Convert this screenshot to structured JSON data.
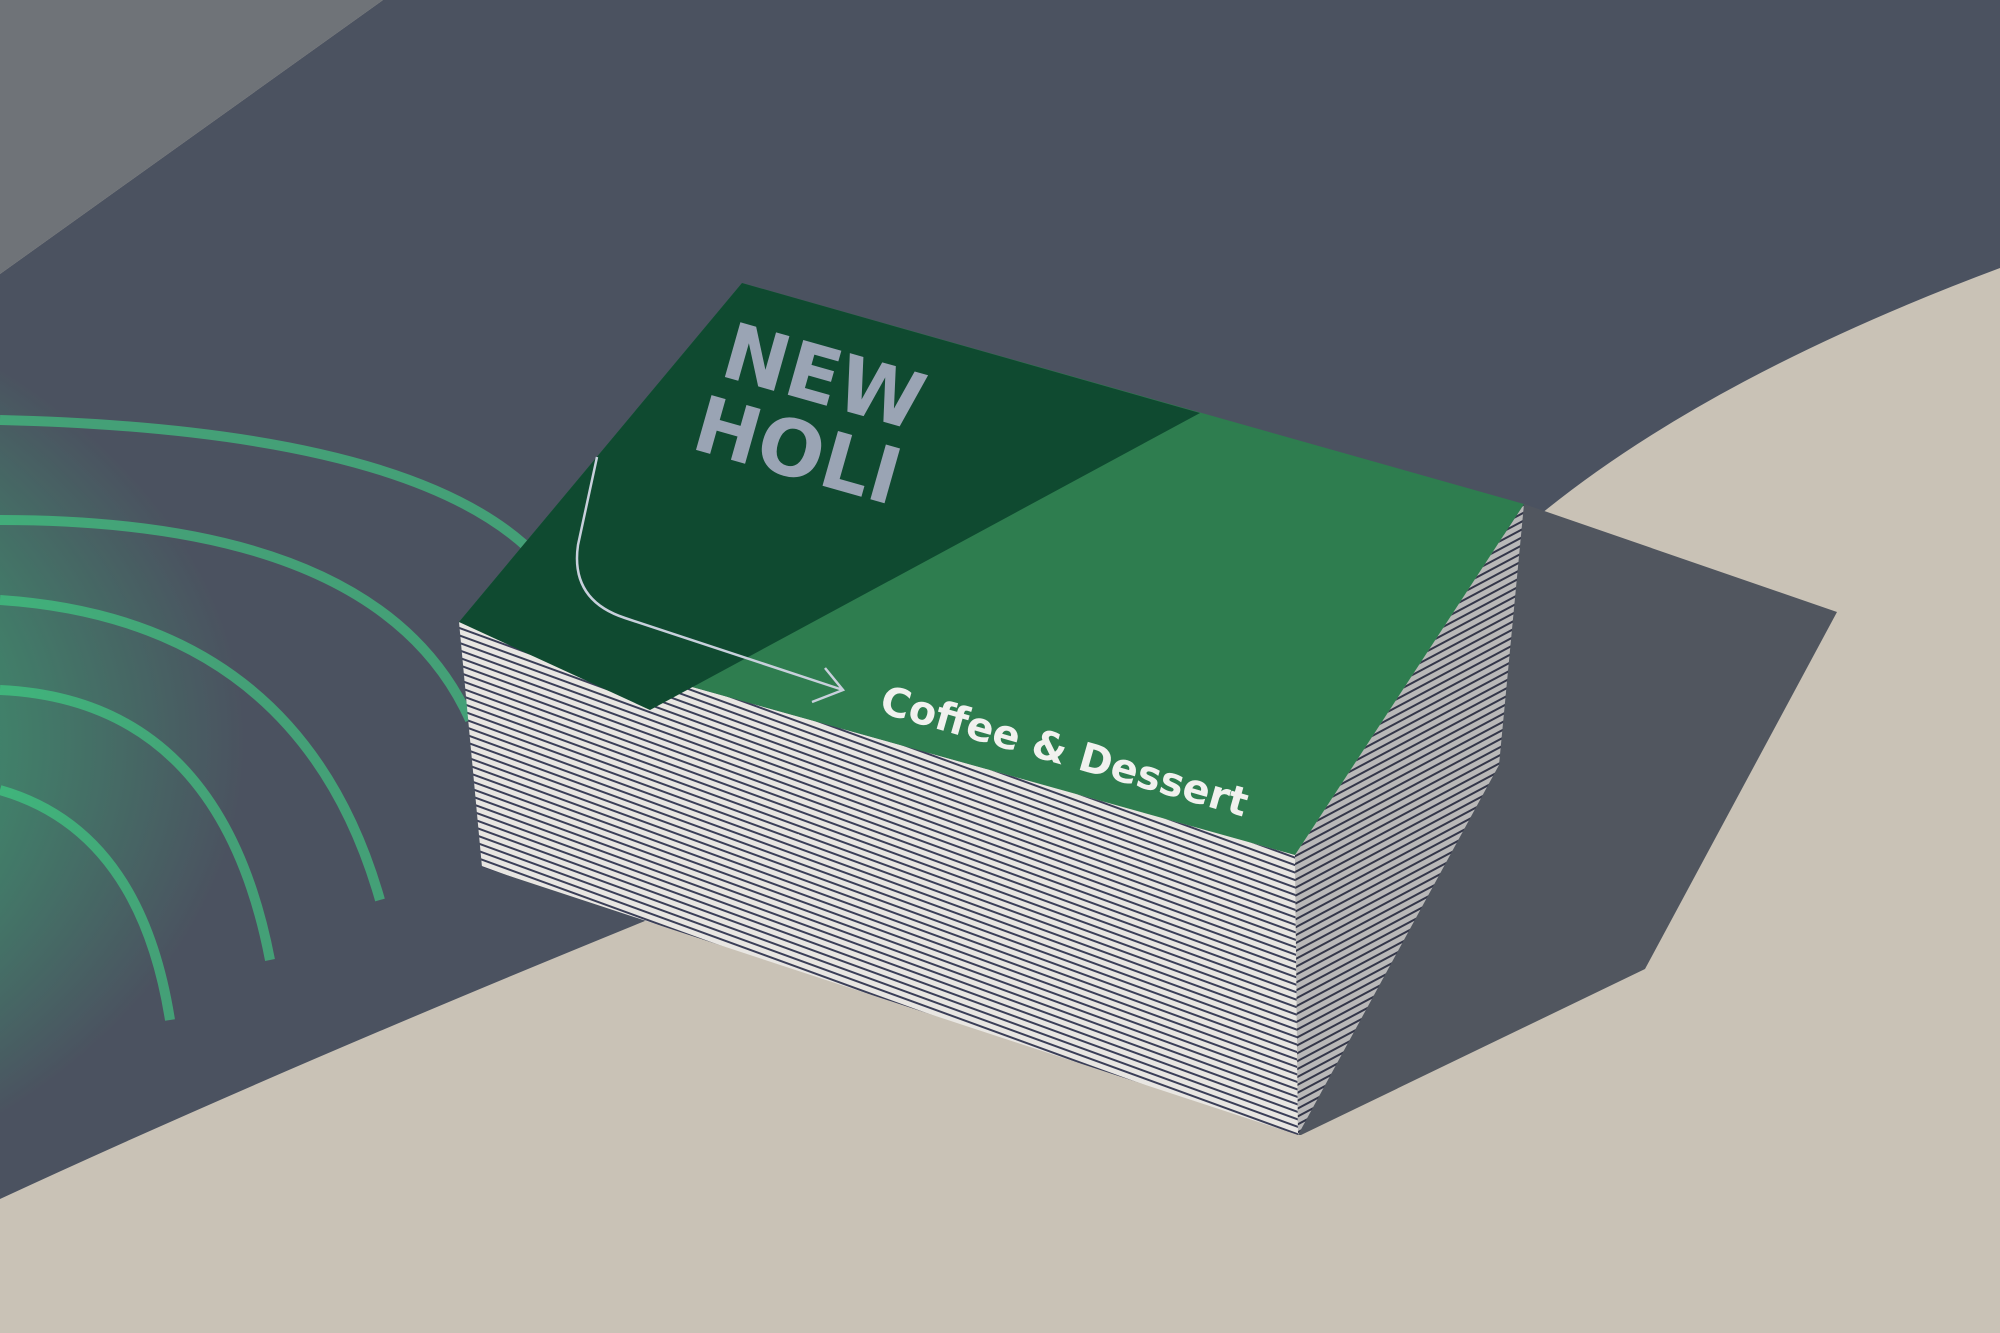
{
  "scene": {
    "description_colors": {
      "surface_light": "#c9c2b6",
      "surface_shadow": "#4b5260",
      "card_green": "#2e7d4f",
      "card_green_shadowed": "#0f4a30",
      "caustic_green": "#2fd07a",
      "logo_color": "#9aa4b4",
      "text_color": "#f1f1ee"
    }
  },
  "card": {
    "logo_line1": "NEW",
    "logo_line2": "HOLI",
    "tagline": "Coffee & Dessert"
  }
}
